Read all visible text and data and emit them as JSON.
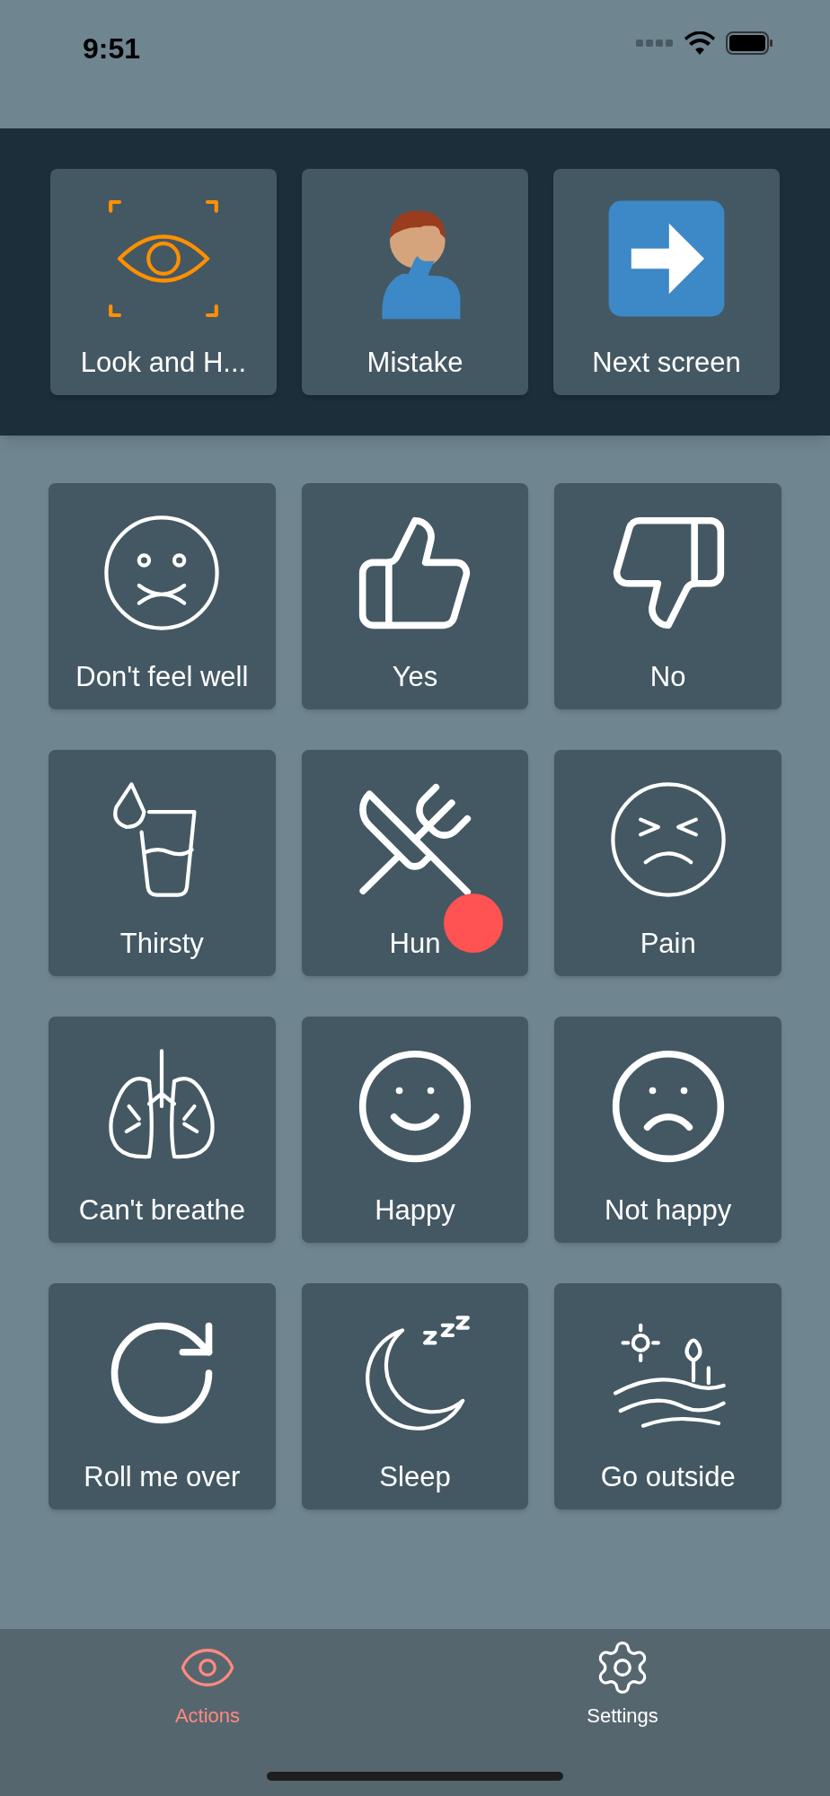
{
  "status_bar": {
    "time": "9:51"
  },
  "quick_actions": [
    {
      "label": "Look and H..."
    },
    {
      "label": "Mistake"
    },
    {
      "label": "Next screen"
    }
  ],
  "phrases": [
    {
      "label": "Don't feel well"
    },
    {
      "label": "Yes"
    },
    {
      "label": "No"
    },
    {
      "label": "Thirsty"
    },
    {
      "label": "Hun",
      "touched": true
    },
    {
      "label": "Pain"
    },
    {
      "label": "Can't breathe"
    },
    {
      "label": "Happy"
    },
    {
      "label": "Not happy"
    },
    {
      "label": "Roll me over"
    },
    {
      "label": "Sleep"
    },
    {
      "label": "Go outside"
    }
  ],
  "tab_bar": [
    {
      "label": "Actions",
      "selected": true
    },
    {
      "label": "Settings",
      "selected": false
    }
  ]
}
